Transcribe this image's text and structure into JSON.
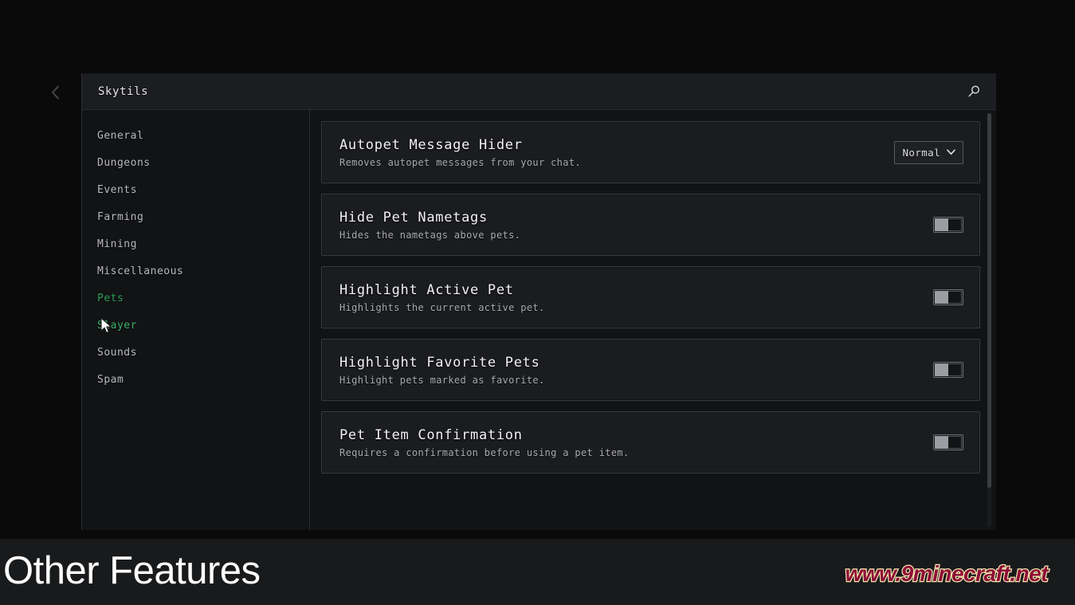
{
  "window": {
    "title": "Skytils",
    "back_icon": "chevron-left-icon",
    "search_icon": "search-icon"
  },
  "sidebar": {
    "items": [
      {
        "label": "General",
        "state": "normal"
      },
      {
        "label": "Dungeons",
        "state": "normal"
      },
      {
        "label": "Events",
        "state": "normal"
      },
      {
        "label": "Farming",
        "state": "normal"
      },
      {
        "label": "Mining",
        "state": "normal"
      },
      {
        "label": "Miscellaneous",
        "state": "normal"
      },
      {
        "label": "Pets",
        "state": "selected"
      },
      {
        "label": "Slayer",
        "state": "hovered"
      },
      {
        "label": "Sounds",
        "state": "normal"
      },
      {
        "label": "Spam",
        "state": "normal"
      }
    ]
  },
  "settings": {
    "cards": [
      {
        "title": "Autopet Message Hider",
        "description": "Removes autopet messages from your chat.",
        "control": "dropdown",
        "value": "Normal",
        "chevron_icon": "chevron-down-icon"
      },
      {
        "title": "Hide Pet Nametags",
        "description": "Hides the nametags above pets.",
        "control": "toggle",
        "value": "off"
      },
      {
        "title": "Highlight Active Pet",
        "description": "Highlights the current active pet.",
        "control": "toggle",
        "value": "off"
      },
      {
        "title": "Highlight Favorite Pets",
        "description": "Highlight pets marked as favorite.",
        "control": "toggle",
        "value": "off"
      },
      {
        "title": "Pet Item Confirmation",
        "description": "Requires a confirmation before using a pet item.",
        "control": "toggle",
        "value": "off"
      }
    ]
  },
  "overlay": {
    "caption": "Other Features",
    "watermark": "www.9minecraft.net"
  },
  "colors": {
    "accent_green": "#2ea05a",
    "panel_bg": "#121315",
    "card_bg": "#1b1c1f",
    "header_bg": "#1c1d20",
    "watermark_fill": "#8e0d38",
    "watermark_outline": "#f5e9b0"
  }
}
